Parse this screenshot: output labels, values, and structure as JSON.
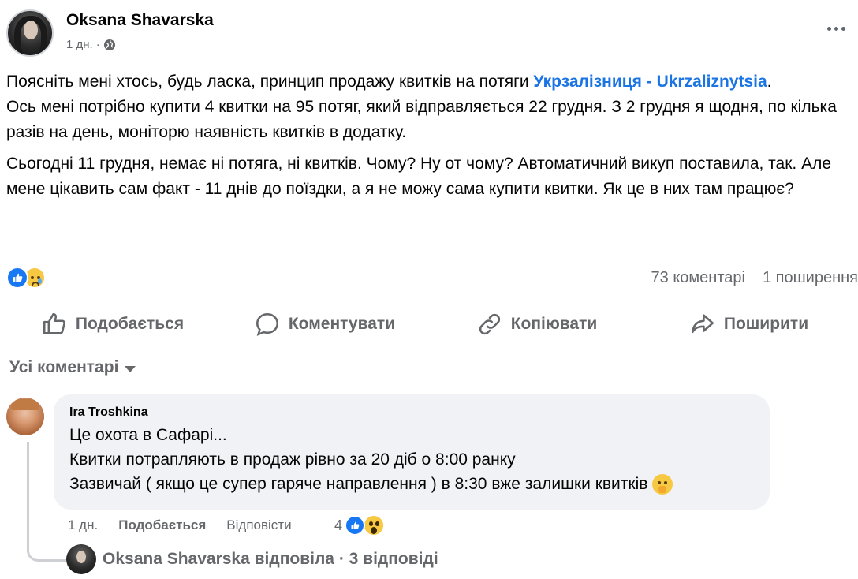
{
  "post": {
    "author": "Oksana Shavarska",
    "time": "1 дн.",
    "separator": "·",
    "text_p1_before": "Поясніть мені хтось, будь ласка, принцип продажу квитків на потяги ",
    "text_p1_link": "Укрзалізниця - Ukrzaliznytsia",
    "text_p1_after": ".",
    "text_p1_line2": "Ось мені потрібно купити 4 квитки на 95 потяг, який відправляється 22 грудня. З 2 грудня я щодня, по кілька разів на день, моніторю наявність квитків в додатку.",
    "text_p2": "Сьогодні 11 грудня, немає ні потяга, ні квитків. Чому? Ну от чому? Автоматичний викуп поставила, так. Але мене цікавить сам факт - 11 днів до поїздки, а я не можу сама купити квитки. Як це в них там працює?",
    "reactions": [
      "like",
      "sad"
    ],
    "comments_count": "73 коментарі",
    "shares_count": "1 поширення"
  },
  "actions": {
    "like": "Подобається",
    "comment": "Коментувати",
    "copy": "Копіювати",
    "share": "Поширити"
  },
  "comments_filter": "Усі коментарі",
  "comment": {
    "author": "Ira Troshkina",
    "line1": "Це охота в Сафарі...",
    "line2": "Квитки потрапляють в продаж рівно за 20 діб о 8:00 ранку",
    "line3": "Зазвичай ( якщо це супер гаряче направлення ) в 8:30 вже залишки квитків",
    "time": "1 дн.",
    "like_label": "Подобається",
    "reply_label": "Відповісти",
    "reaction_count": "4",
    "reactions": [
      "like",
      "wow"
    ]
  },
  "reply_summary": "Oksana Shavarska відповіла · 3 відповіді",
  "colors": {
    "link": "#1b74e4",
    "secondary_text": "#65676b",
    "bubble": "#f0f2f5",
    "like_blue": "#1877f2"
  }
}
